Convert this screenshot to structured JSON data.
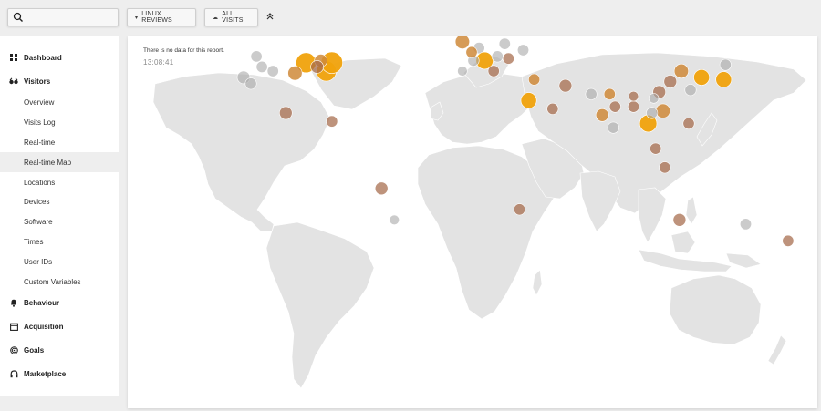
{
  "search": {
    "placeholder": ""
  },
  "site_selector": {
    "label": "LINUX REVIEWS"
  },
  "segment_selector": {
    "label": "ALL VISITS"
  },
  "sidebar": {
    "categories": [
      {
        "label": "Dashboard",
        "icon": "grid-icon"
      },
      {
        "label": "Visitors",
        "icon": "glasses-icon",
        "items": [
          "Overview",
          "Visits Log",
          "Real-time",
          "Real-time Map",
          "Locations",
          "Devices",
          "Software",
          "Times",
          "User IDs",
          "Custom Variables"
        ],
        "active_item": "Real-time Map"
      },
      {
        "label": "Behaviour",
        "icon": "bell-icon"
      },
      {
        "label": "Acquisition",
        "icon": "calendar-icon"
      },
      {
        "label": "Goals",
        "icon": "target-icon"
      },
      {
        "label": "Marketplace",
        "icon": "headset-icon"
      }
    ]
  },
  "report": {
    "message": "There is no data for this report.",
    "time": "13:08:41"
  },
  "colors": {
    "land": "#e3e3e3",
    "border": "#ffffff",
    "recent": "#f0a20c",
    "mid": "#cf8a3a",
    "old": "#a56a49",
    "stale": "#a9a9a9"
  },
  "visits": [
    {
      "lon": -88,
      "lat": 44,
      "level": 1,
      "weight": 1.0
    },
    {
      "lon": -77,
      "lat": 40,
      "level": 1,
      "weight": 1.0
    },
    {
      "lon": -74,
      "lat": 44,
      "level": 1,
      "weight": 1.1
    },
    {
      "lon": -94,
      "lat": 39,
      "level": 2,
      "weight": 0.6
    },
    {
      "lon": -80,
      "lat": 45,
      "level": 2,
      "weight": 0.5
    },
    {
      "lon": -106,
      "lat": 40,
      "level": 4,
      "weight": 0.4
    },
    {
      "lon": -122,
      "lat": 37,
      "level": 4,
      "weight": 0.5
    },
    {
      "lon": -118,
      "lat": 34,
      "level": 4,
      "weight": 0.4
    },
    {
      "lon": -115,
      "lat": 47,
      "level": 4,
      "weight": 0.4
    },
    {
      "lon": -112,
      "lat": 42,
      "level": 4,
      "weight": 0.4
    },
    {
      "lon": -82,
      "lat": 42,
      "level": 3,
      "weight": 0.5
    },
    {
      "lon": -99,
      "lat": 20,
      "level": 3,
      "weight": 0.5
    },
    {
      "lon": -74,
      "lat": 16,
      "level": 3,
      "weight": 0.4
    },
    {
      "lon": -47,
      "lat": -16,
      "level": 3,
      "weight": 0.5
    },
    {
      "lon": -40,
      "lat": -31,
      "level": 4,
      "weight": 0.3
    },
    {
      "lon": -3,
      "lat": 54,
      "level": 2,
      "weight": 0.6
    },
    {
      "lon": 6,
      "lat": 51,
      "level": 4,
      "weight": 0.4
    },
    {
      "lon": 9,
      "lat": 45,
      "level": 1,
      "weight": 0.8
    },
    {
      "lon": 16,
      "lat": 47,
      "level": 4,
      "weight": 0.4
    },
    {
      "lon": 20,
      "lat": 53,
      "level": 4,
      "weight": 0.4
    },
    {
      "lon": 3,
      "lat": 45,
      "level": 4,
      "weight": 0.4
    },
    {
      "lon": 14,
      "lat": 40,
      "level": 3,
      "weight": 0.4
    },
    {
      "lon": 22,
      "lat": 46,
      "level": 3,
      "weight": 0.4
    },
    {
      "lon": 30,
      "lat": 50,
      "level": 4,
      "weight": 0.4
    },
    {
      "lon": 26,
      "lat": 59,
      "level": 4,
      "weight": 0.3
    },
    {
      "lon": 36,
      "lat": 36,
      "level": 2,
      "weight": 0.4
    },
    {
      "lon": 33,
      "lat": 26,
      "level": 1,
      "weight": 0.7
    },
    {
      "lon": 53,
      "lat": 33,
      "level": 3,
      "weight": 0.5
    },
    {
      "lon": 46,
      "lat": 22,
      "level": 3,
      "weight": 0.4
    },
    {
      "lon": 67,
      "lat": 29,
      "level": 4,
      "weight": 0.4
    },
    {
      "lon": 73,
      "lat": 19,
      "level": 2,
      "weight": 0.5
    },
    {
      "lon": 79,
      "lat": 13,
      "level": 4,
      "weight": 0.4
    },
    {
      "lon": 77,
      "lat": 29,
      "level": 2,
      "weight": 0.4
    },
    {
      "lon": 80,
      "lat": 23,
      "level": 3,
      "weight": 0.4
    },
    {
      "lon": 90,
      "lat": 23,
      "level": 3,
      "weight": 0.4
    },
    {
      "lon": 98,
      "lat": 15,
      "level": 1,
      "weight": 0.8
    },
    {
      "lon": 104,
      "lat": 30,
      "level": 3,
      "weight": 0.5
    },
    {
      "lon": 106,
      "lat": 21,
      "level": 2,
      "weight": 0.6
    },
    {
      "lon": 102,
      "lat": 3,
      "level": 3,
      "weight": 0.4
    },
    {
      "lon": 107,
      "lat": -6,
      "level": 3,
      "weight": 0.4
    },
    {
      "lon": 110,
      "lat": 35,
      "level": 3,
      "weight": 0.5
    },
    {
      "lon": 116,
      "lat": 40,
      "level": 2,
      "weight": 0.6
    },
    {
      "lon": 121,
      "lat": 31,
      "level": 4,
      "weight": 0.4
    },
    {
      "lon": 120,
      "lat": 15,
      "level": 3,
      "weight": 0.4
    },
    {
      "lon": 127,
      "lat": 37,
      "level": 1,
      "weight": 0.7
    },
    {
      "lon": 139,
      "lat": 36,
      "level": 1,
      "weight": 0.7
    },
    {
      "lon": 140,
      "lat": 43,
      "level": 4,
      "weight": 0.4
    },
    {
      "lon": 115,
      "lat": -31,
      "level": 3,
      "weight": 0.5
    },
    {
      "lon": 151,
      "lat": -33,
      "level": 4,
      "weight": 0.4
    },
    {
      "lon": 174,
      "lat": -41,
      "level": 3,
      "weight": 0.4
    },
    {
      "lon": 28,
      "lat": -26,
      "level": 3,
      "weight": 0.4
    },
    {
      "lon": 90,
      "lat": 28,
      "level": 3,
      "weight": 0.3
    },
    {
      "lon": 100,
      "lat": 20,
      "level": 4,
      "weight": 0.4
    },
    {
      "lon": 101,
      "lat": 27,
      "level": 4,
      "weight": 0.3
    },
    {
      "lon": 2,
      "lat": 49,
      "level": 2,
      "weight": 0.4
    },
    {
      "lon": -3,
      "lat": 40,
      "level": 4,
      "weight": 0.3
    }
  ]
}
